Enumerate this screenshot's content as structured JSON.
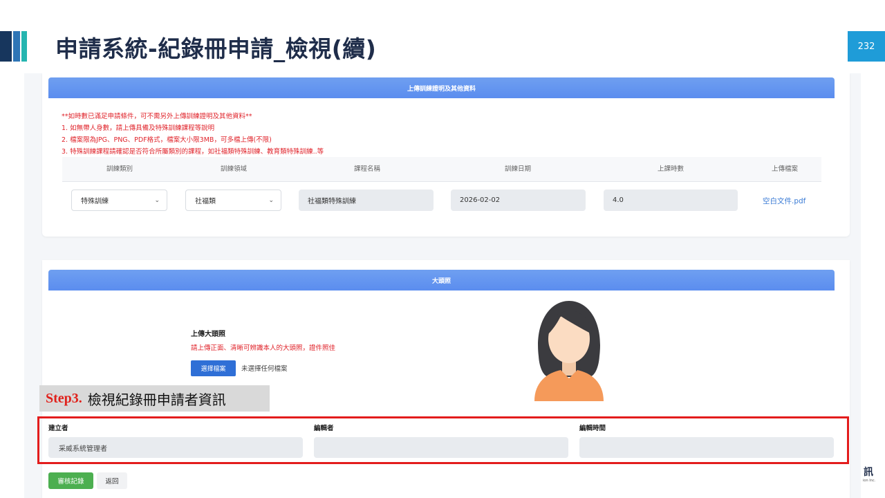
{
  "slide": {
    "title": "申請系統-紀錄冊申請_檢視(續)",
    "page_number": "232",
    "logo_text": "訊",
    "logo_sub": "ion Inc.",
    "colors": {
      "title": "#1f2d4a",
      "page_badge": "#1f9cd8",
      "annotation_red": "#e31c1c"
    }
  },
  "training_section": {
    "header": "上傳訓練證明及其他資料",
    "notes": [
      "**如時數已滿足申請條件，可不需另外上傳訓練證明及其他資料**",
      "1. 如無帶人身數，請上傳具備及特殊訓練課程等說明",
      "2. 檔案限為JPG、PNG、PDF格式，檔案大小限3MB，可多檔上傳(不限)",
      "3. 特殊訓練課程請確認是否符合所屬類別的課程，如社福類特殊訓練、教育類特殊訓練..等"
    ],
    "columns": [
      "訓練類別",
      "訓練領域",
      "課程名稱",
      "訓練日期",
      "上課時數",
      "上傳檔案"
    ],
    "row": {
      "category": "特殊訓練",
      "domain": "社福類",
      "course": "社福類特殊訓練",
      "date": "2026-02-02",
      "hours": "4.0",
      "file": "空白文件.pdf"
    }
  },
  "photo_section": {
    "header": "大頭照",
    "upload_title": "上傳大頭照",
    "upload_hint": "請上傳正面、清晰可辨識本人的大頭照，證件照佳",
    "choose_button": "選擇檔案",
    "no_file_text": "未選擇任何檔案"
  },
  "record_info": {
    "creator_label": "建立者",
    "creator_value": "采威系統管理者",
    "editor_label": "編輯者",
    "editor_value": "",
    "edit_time_label": "編輯時間",
    "edit_time_value": ""
  },
  "actions": {
    "review_log": "審核記錄",
    "back": "返回"
  },
  "annotation": {
    "step": "Step3.",
    "text": "檢視紀錄冊申請者資訊"
  }
}
